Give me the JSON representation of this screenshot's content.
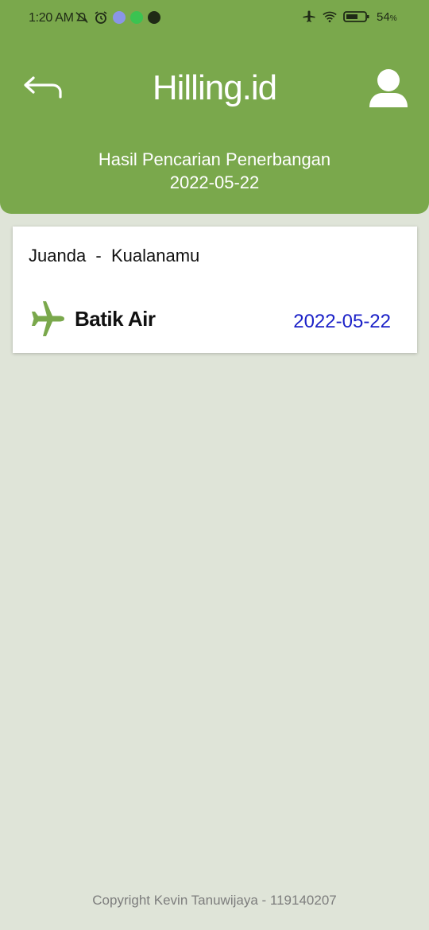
{
  "status": {
    "time": "1:20 AM",
    "battery": "54",
    "battery_unit": "%",
    "left_icons": [
      "notification-muted-icon",
      "alarm-icon",
      "discord-icon",
      "whatsapp-icon",
      "app-icon"
    ],
    "right_icons": [
      "airplane-mode-icon",
      "wifi-icon",
      "battery-icon"
    ]
  },
  "header": {
    "title": "Hilling.id",
    "subtitle_line1": "Hasil Pencarian Penerbangan",
    "subtitle_line2": "2022-05-22",
    "back_icon": "back-arrow-icon",
    "profile_icon": "user-icon",
    "color": "#7aa84c"
  },
  "results": [
    {
      "route": "Juanda  -  Kualanamu",
      "airline": "Batik Air",
      "date": "2022-05-22",
      "icon": "airplane-icon"
    }
  ],
  "footer": {
    "copyright": "Copyright Kevin Tanuwijaya - 119140207"
  },
  "colors": {
    "background": "#dfe4d8",
    "accent": "#7aa84c",
    "date_text": "#1c22c8"
  }
}
